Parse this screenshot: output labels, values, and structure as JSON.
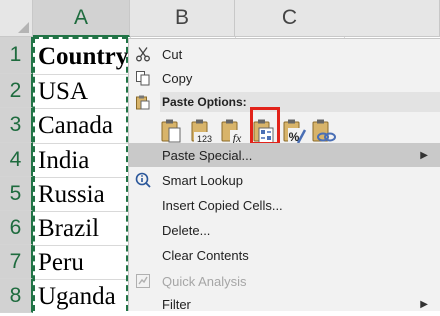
{
  "columns": [
    "A",
    "B",
    "C"
  ],
  "rows": [
    "1",
    "2",
    "3",
    "4",
    "5",
    "6",
    "7",
    "8"
  ],
  "cells": [
    "Country",
    "USA",
    "Canada",
    "India",
    "Russia",
    "Brazil",
    "Peru",
    "Uganda"
  ],
  "menu": {
    "cut": "Cut",
    "copy": "Copy",
    "paste_options": "Paste Options:",
    "paste_icons": [
      "paste-icon",
      "paste-values-icon",
      "paste-formulas-icon",
      "paste-transpose-icon",
      "paste-formatting-icon",
      "paste-link-icon"
    ],
    "paste_icon_text": {
      "values": "123",
      "formulas": "fx",
      "formatting": "%"
    },
    "paste_special": "Paste Special...",
    "smart_lookup": "Smart Lookup",
    "insert_copied_cells": "Insert Copied Cells...",
    "delete": "Delete...",
    "clear_contents": "Clear Contents",
    "quick_analysis": "Quick Analysis",
    "filter": "Filter"
  },
  "colors": {
    "excel_green": "#217346",
    "highlight_red": "#e2231a",
    "menu_bg": "#f2f2f2",
    "hover_bg": "#c9c9c9"
  }
}
